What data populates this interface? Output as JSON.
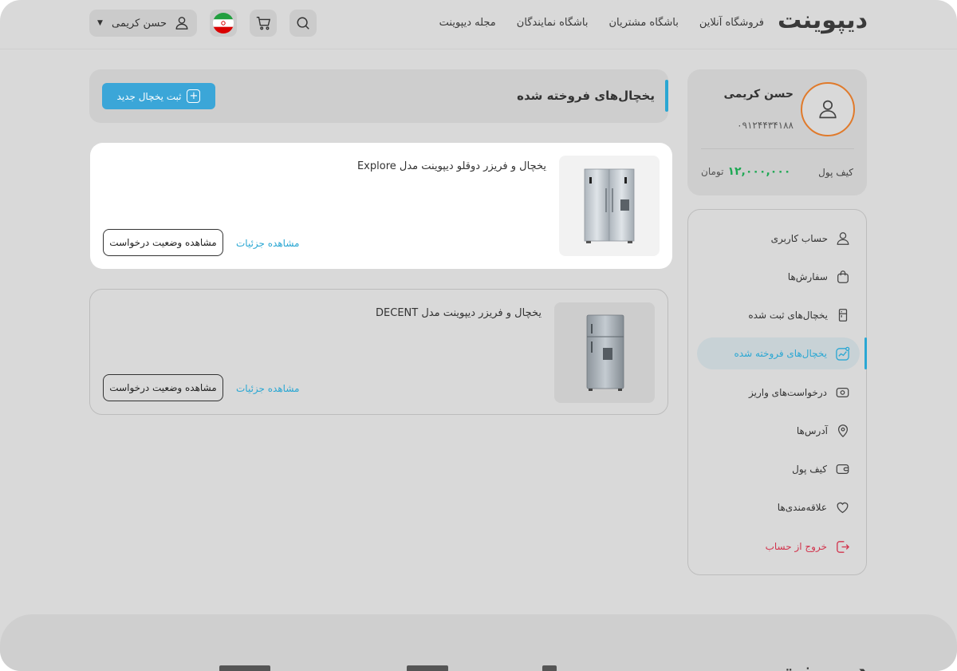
{
  "header": {
    "logo": "دیپوینت",
    "nav": [
      "فروشگاه آنلاین",
      "باشگاه مشتریان",
      "باشگاه نمایندگان",
      "مجله دیپوینت"
    ],
    "user_name": "حسن کریمی"
  },
  "profile": {
    "name": "حسن کریمی",
    "phone": "۰۹۱۲۴۴۳۴۱۸۸",
    "wallet_label": "کیف پول",
    "wallet_amount": "۱۲,۰۰۰,۰۰۰",
    "wallet_unit": "تومان"
  },
  "sidebar": {
    "items": [
      {
        "label": "حساب کاربری",
        "icon": "user-icon"
      },
      {
        "label": "سفارش‌ها",
        "icon": "bag-icon"
      },
      {
        "label": "یخچال‌های ثبت شده",
        "icon": "fridge-icon"
      },
      {
        "label": "یخچال‌های فروخته شده",
        "icon": "chart-icon"
      },
      {
        "label": "درخواست‌های واریز",
        "icon": "money-icon"
      },
      {
        "label": "آدرس‌ها",
        "icon": "location-icon"
      },
      {
        "label": "کیف پول",
        "icon": "wallet-icon"
      },
      {
        "label": "علاقه‌مندی‌ها",
        "icon": "heart-icon"
      },
      {
        "label": "خروج از حساب",
        "icon": "logout-icon"
      }
    ],
    "active_index": 3
  },
  "main": {
    "title": "یخچال‌های فروخته شده",
    "new_button": "ثبت یخچال جدید",
    "products": [
      {
        "name": "یخچال و فریزر دوقلو دیپوینت مدل Explore",
        "details": "مشاهده جزئیات",
        "status": "مشاهده وضعیت درخواست"
      },
      {
        "name": "یخچال و فریزر دیپوینت مدل DECENT",
        "details": "مشاهده جزئیات",
        "status": "مشاهده وضعیت درخواست"
      }
    ]
  },
  "footer": {
    "logo": "دیپوینت"
  }
}
